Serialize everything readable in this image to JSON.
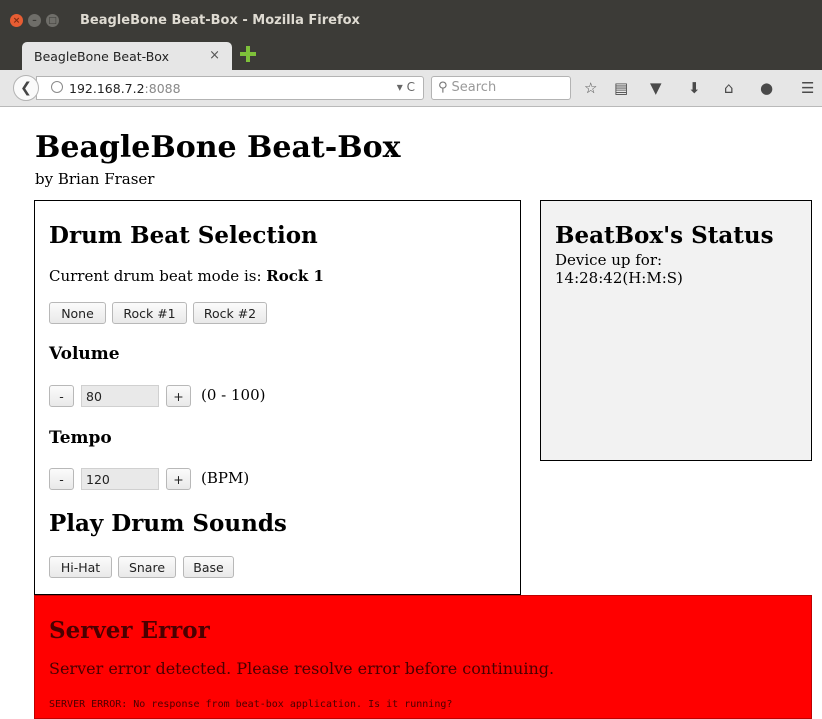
{
  "window": {
    "title": "BeagleBone Beat-Box - Mozilla Firefox",
    "buttons": [
      "×",
      "–",
      "□"
    ]
  },
  "tab": {
    "title": "BeagleBone Beat-Box",
    "close": "×"
  },
  "navbar": {
    "url_host": "192.168.7.2",
    "url_port": ":8088",
    "url_actions": "▾ C",
    "search_placeholder": "Search",
    "icons": [
      "back-arrow-icon",
      "globe-icon",
      "reload-icon",
      "search-icon",
      "bookmark-star-icon",
      "reading-list-icon",
      "pocket-icon",
      "download-icon",
      "home-icon",
      "chat-icon",
      "menu-icon"
    ]
  },
  "page": {
    "title": "BeagleBone Beat-Box",
    "byline": "by Brian Fraser"
  },
  "drum": {
    "heading": "Drum Beat Selection",
    "mode_prefix": "Current drum beat mode is: ",
    "mode_value": "Rock 1",
    "buttons": [
      "None",
      "Rock #1",
      "Rock #2"
    ],
    "volume": {
      "heading": "Volume",
      "minus": "-",
      "value": "80",
      "plus": "+",
      "range": "(0 - 100)"
    },
    "tempo": {
      "heading": "Tempo",
      "minus": "-",
      "value": "120",
      "plus": "+",
      "unit": "(BPM)"
    },
    "sounds": {
      "heading": "Play Drum Sounds",
      "buttons": [
        "Hi-Hat",
        "Snare",
        "Base"
      ]
    }
  },
  "status": {
    "heading": "BeatBox's Status",
    "line1": "Device up for:",
    "line2": "14:28:42(H:M:S)"
  },
  "error": {
    "heading": "Server Error",
    "message": "Server error detected. Please resolve error before continuing.",
    "detail": "SERVER ERROR: No response from beat-box application. Is it running?"
  },
  "colors": {
    "error_bg": "#ff0000",
    "status_bg": "#f2f2f2",
    "titlebar": "#3c3b37"
  }
}
